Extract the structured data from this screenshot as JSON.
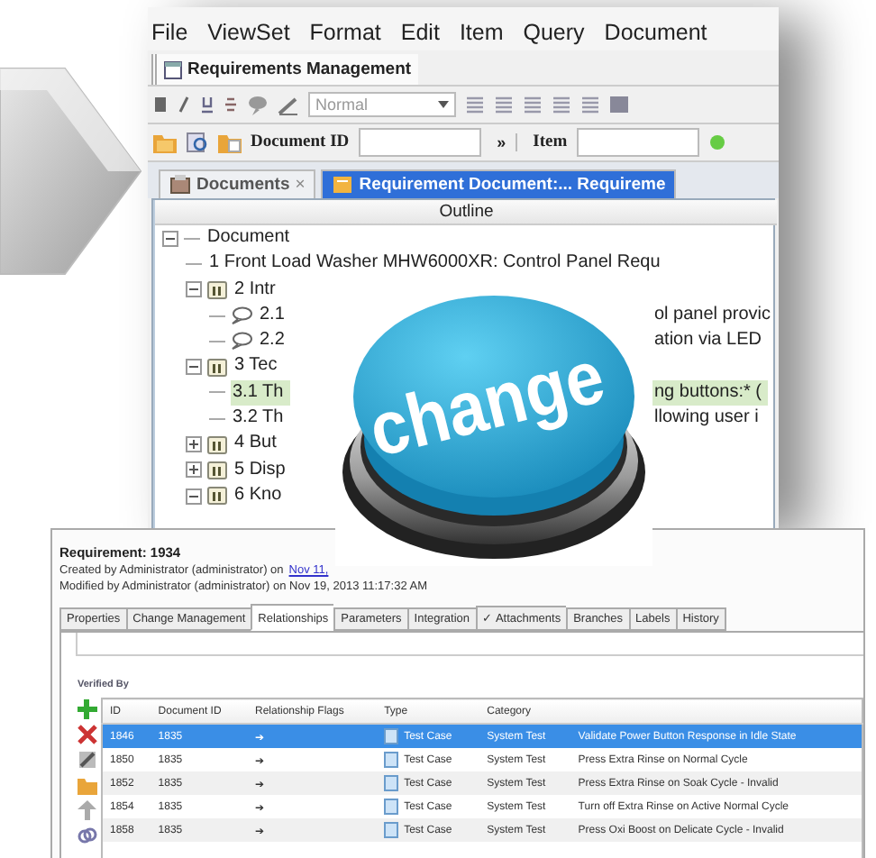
{
  "requirements_window": {
    "menu": [
      "File",
      "ViewSet",
      "Format",
      "Edit",
      "Item",
      "Query",
      "Document"
    ],
    "perspective": "Requirements Management",
    "format_toolbar": {
      "style": "Normal"
    },
    "search_toolbar": {
      "document_id_label": "Document ID",
      "more": "»",
      "item_label": "Item"
    },
    "tabs": [
      {
        "label": "Documents",
        "close": "×",
        "selected": false
      },
      {
        "label": "Requirement Document:... Requireme",
        "selected": true
      }
    ],
    "outline": {
      "header": "Outline",
      "tree": [
        {
          "kind": "root",
          "label": "Document",
          "expanded": true,
          "selected": false,
          "children": [
            {
              "kind": "text",
              "label": "1 Front Load Washer MHW6000XR: Control Panel Requ",
              "selected": false
            },
            {
              "kind": "heading",
              "label": "2 Intr",
              "expanded": true,
              "selected": false,
              "children": [
                {
                  "kind": "comment",
                  "label": "2.1",
                  "label_right": "ol panel provic",
                  "selected": false
                },
                {
                  "kind": "comment",
                  "label": "2.2",
                  "label_right": "ation via LED",
                  "selected": false
                }
              ]
            },
            {
              "kind": "heading",
              "label": "3 Tec",
              "expanded": true,
              "selected": false,
              "children": [
                {
                  "kind": "text",
                  "label": "3.1 Th",
                  "label_right": "ng buttons:* (",
                  "selected": true
                },
                {
                  "kind": "text",
                  "label": "3.2 Th",
                  "label_right": "llowing user i",
                  "selected": false
                }
              ]
            },
            {
              "kind": "heading",
              "label": "4 But",
              "expanded": false,
              "selected": false
            },
            {
              "kind": "heading",
              "label": "5 Disp",
              "expanded": false,
              "selected": false
            },
            {
              "kind": "heading",
              "label": "6 Kno",
              "expanded": true,
              "selected": false
            }
          ]
        }
      ]
    }
  },
  "badge": {
    "text": "change"
  },
  "detail_window": {
    "title": "Requirement: 1934",
    "created": "Created by Administrator (administrator) on",
    "created_link": "Nov 11,",
    "modified": "Modified by Administrator (administrator) on Nov 19, 2013 11:17:32 AM",
    "tabs": [
      {
        "label": "Properties",
        "selected": false
      },
      {
        "label": "Change Management",
        "selected": false
      },
      {
        "label": "Relationships",
        "selected": true
      },
      {
        "label": "Parameters",
        "selected": false
      },
      {
        "label": "Integration",
        "selected": false
      },
      {
        "label": "✓ Attachments",
        "selected": false
      },
      {
        "label": "Branches",
        "selected": false
      },
      {
        "label": "Labels",
        "selected": false
      },
      {
        "label": "History",
        "selected": false
      }
    ],
    "section": "Verified By",
    "columns": [
      "ID",
      "Document ID",
      "Relationship Flags",
      "Type",
      "Category"
    ],
    "rows": [
      {
        "id": "1846",
        "document_id": "1835",
        "flag": "➔",
        "type": "Test Case",
        "category": "System Test",
        "column_6": "Validate Power Button Response in Idle State",
        "selected": true
      },
      {
        "id": "1850",
        "document_id": "1835",
        "flag": "➔",
        "type": "Test Case",
        "category": "System Test",
        "column_6": "Press Extra Rinse on Normal Cycle",
        "selected": false
      },
      {
        "id": "1852",
        "document_id": "1835",
        "flag": "➔",
        "type": "Test Case",
        "category": "System Test",
        "column_6": "Press Extra Rinse on Soak Cycle - Invalid",
        "selected": false
      },
      {
        "id": "1854",
        "document_id": "1835",
        "flag": "➔",
        "type": "Test Case",
        "category": "System Test",
        "column_6": "Turn off Extra Rinse on Active Normal Cycle",
        "selected": false
      },
      {
        "id": "1858",
        "document_id": "1835",
        "flag": "➔",
        "type": "Test Case",
        "category": "System Test",
        "column_6": "Press Oxi Boost on Delicate Cycle - Invalid",
        "selected": false
      }
    ]
  }
}
